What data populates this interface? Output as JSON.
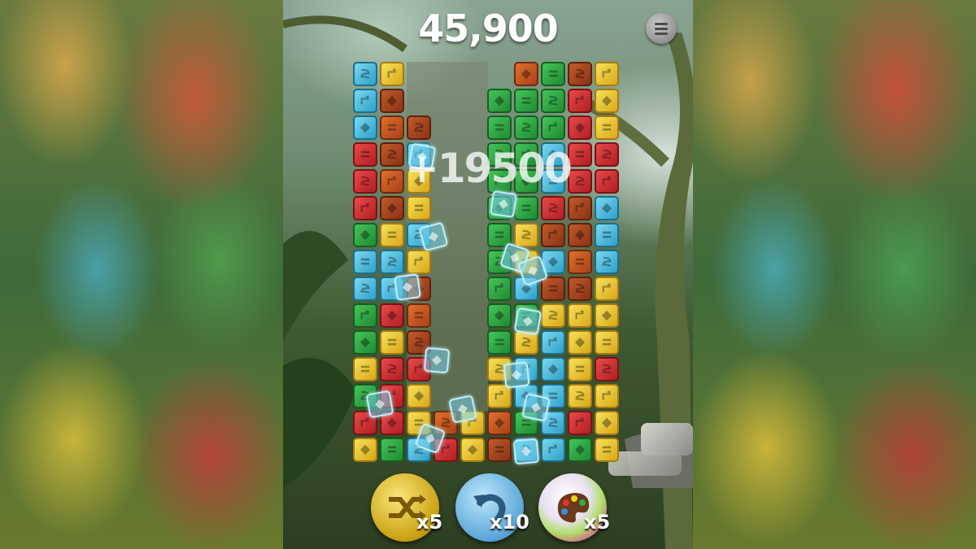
{
  "score": "45,900",
  "bonus_popup": "+19500",
  "menu": {
    "icon": "hamburger-menu-icon"
  },
  "powerups": [
    {
      "name": "shuffle",
      "icon": "shuffle-icon",
      "count": "x5",
      "color": "#e6c42a"
    },
    {
      "name": "undo",
      "icon": "undo-icon",
      "count": "x10",
      "color": "#6fb6e2"
    },
    {
      "name": "color-palette",
      "icon": "palette-icon",
      "count": "x5",
      "color": "#e84aa0"
    }
  ],
  "colors": {
    "yellow": "#e6c42a",
    "red": "#d0302f",
    "green": "#2fae45",
    "blue": "#4cbbe0",
    "orange": "#c85a22",
    "brown": "#a84220"
  },
  "board": {
    "grid": [
      [
        "blue",
        "yellow",
        "",
        "",
        "",
        "",
        "orange",
        "green",
        "brown",
        "yellow"
      ],
      [
        "blue",
        "brown",
        "",
        "",
        "",
        "green",
        "green",
        "green",
        "red",
        "yellow"
      ],
      [
        "blue",
        "orange",
        "brown",
        "",
        "",
        "green",
        "green",
        "green",
        "red",
        "yellow"
      ],
      [
        "red",
        "brown",
        "blue",
        "",
        "",
        "green",
        "green",
        "blue",
        "red",
        "red"
      ],
      [
        "red",
        "orange",
        "yellow",
        "",
        "",
        "green",
        "green",
        "blue",
        "red",
        "red"
      ],
      [
        "red",
        "brown",
        "yellow",
        "",
        "",
        "green",
        "green",
        "red",
        "brown",
        "blue"
      ],
      [
        "green",
        "yellow",
        "blue",
        "",
        "",
        "green",
        "yellow",
        "brown",
        "brown",
        "blue"
      ],
      [
        "blue",
        "blue",
        "yellow",
        "",
        "",
        "green",
        "yellow",
        "blue",
        "orange",
        "blue"
      ],
      [
        "blue",
        "blue",
        "brown",
        "",
        "",
        "green",
        "blue",
        "brown",
        "brown",
        "yellow"
      ],
      [
        "green",
        "red",
        "orange",
        "",
        "",
        "green",
        "green",
        "yellow",
        "yellow",
        "yellow"
      ],
      [
        "green",
        "yellow",
        "brown",
        "",
        "",
        "green",
        "yellow",
        "blue",
        "yellow",
        "yellow"
      ],
      [
        "yellow",
        "red",
        "red",
        "",
        "",
        "yellow",
        "blue",
        "blue",
        "yellow",
        "red"
      ],
      [
        "green",
        "red",
        "yellow",
        "",
        "",
        "yellow",
        "blue",
        "blue",
        "yellow",
        "yellow"
      ],
      [
        "red",
        "red",
        "yellow",
        "orange",
        "yellow",
        "orange",
        "green",
        "blue",
        "red",
        "yellow"
      ],
      [
        "yellow",
        "green",
        "blue",
        "red",
        "yellow",
        "brown",
        "blue",
        "blue",
        "green",
        "yellow"
      ]
    ],
    "floating_ice_tiles": 14
  }
}
